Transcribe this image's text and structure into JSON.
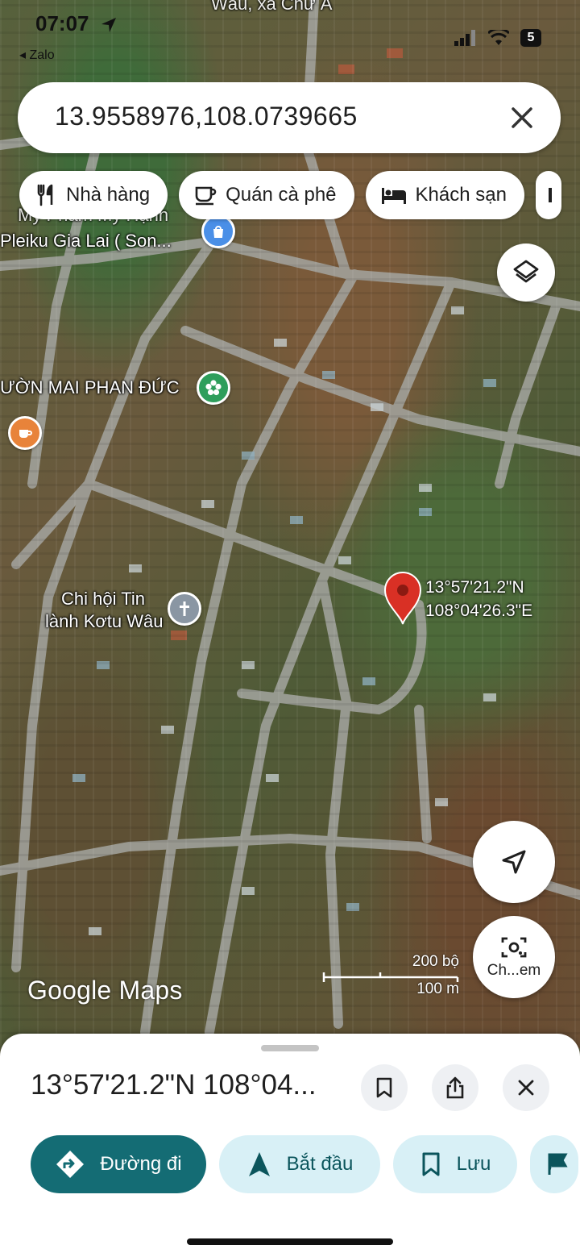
{
  "status_bar": {
    "time": "07:07",
    "back_app": "◂ Zalo",
    "battery": "5"
  },
  "search": {
    "query": "13.9558976,108.0739665"
  },
  "chips": [
    {
      "label": "Nhà hàng",
      "icon": "fork-knife-icon"
    },
    {
      "label": "Quán cà phê",
      "icon": "coffee-cup-icon"
    },
    {
      "label": "Khách sạn",
      "icon": "bed-icon"
    }
  ],
  "map": {
    "labels": {
      "top_partial": "Wâu, xã Chư Á",
      "shop_line1": "Mỹ Phẩm Mỹ Hạnh",
      "shop_line2": "Pleiku Gia Lai ( Son...",
      "garden": "ƯỜN MAI PHAN ĐỨC",
      "church_line1": "Chi hội Tin",
      "church_line2": "lành Kơtu Wâu"
    },
    "pin": {
      "lat": "13°57'21.2\"N",
      "lng": "108°04'26.3\"E"
    },
    "scale": {
      "top": "200 bộ",
      "bottom": "100 m"
    },
    "brand": "Google Maps",
    "lens_label": "Ch...em"
  },
  "sheet": {
    "title": "13°57'21.2\"N 108°04...",
    "actions": [
      {
        "label": "Đường đi",
        "icon": "directions-icon"
      },
      {
        "label": "Bắt đầu",
        "icon": "navigation-arrow-icon"
      },
      {
        "label": "Lưu",
        "icon": "bookmark-icon"
      }
    ]
  },
  "colors": {
    "primary": "#146c74",
    "secondary_bg": "#d8f0f6",
    "pin_red": "#d93025"
  }
}
